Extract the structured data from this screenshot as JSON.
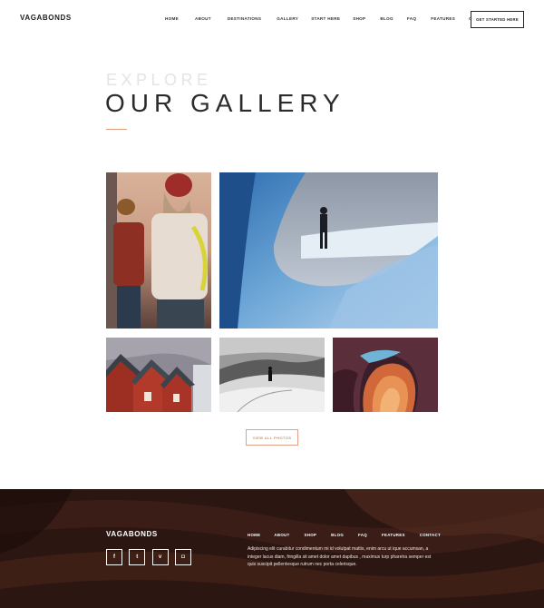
{
  "header": {
    "logo": "VAGABONDS",
    "nav": [
      "HOME",
      "ABOUT",
      "DESTINATIONS",
      "GALLERY",
      "START HERE",
      "SHOP",
      "BLOG",
      "FAQ",
      "FEATURES",
      "CONTACT"
    ],
    "cta": "GET STARTED HERE"
  },
  "hero": {
    "eyebrow": "EXPLORE",
    "title": "OUR GALLERY"
  },
  "gallery": {
    "view_all": "VIEW ALL PHOTOS"
  },
  "footer": {
    "logo": "VAGABONDS",
    "nav": [
      "HOME",
      "ABOUT",
      "SHOP",
      "BLOG",
      "FAQ",
      "FEATURES",
      "CONTACT"
    ],
    "text": "Adipiscing elit curabitur condimentum mi id volutpat mattis, enim arcu ut ique accumsan, a integer lacus diam, fringilla sit amet dolor amet dapibus , maximus turp pharetra semper est quis suscipit pellentesque rutrum nec porta celerisque.",
    "social": [
      {
        "icon": "facebook-icon",
        "glyph": "f"
      },
      {
        "icon": "twitter-icon",
        "glyph": "t"
      },
      {
        "icon": "vimeo-icon",
        "glyph": "v"
      },
      {
        "icon": "instagram-icon",
        "glyph": "◘"
      }
    ]
  },
  "colors": {
    "accent": "#e29e7c",
    "footer_bg": "#2a1511"
  }
}
